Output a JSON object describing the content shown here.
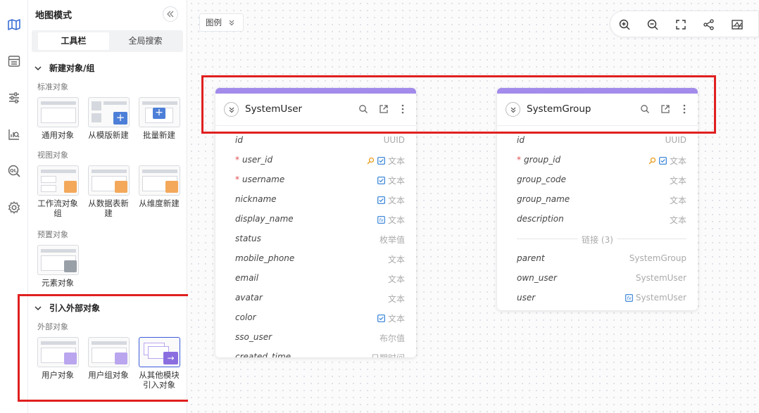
{
  "panel": {
    "title": "地图模式",
    "tabs": [
      "工具栏",
      "全局搜索"
    ],
    "sections": {
      "new_object": {
        "title": "新建对象/组",
        "standard_label": "标准对象",
        "standard_items": [
          "通用对象",
          "从模版新建",
          "批量新建"
        ],
        "view_label": "视图对象",
        "view_items": [
          [
            "工作流对象",
            "组"
          ],
          [
            "从数据表新",
            "建"
          ],
          [
            "从维度新建"
          ]
        ],
        "preset_label": "预置对象",
        "preset_items": [
          "元素对象"
        ]
      },
      "import": {
        "title": "引入外部对象",
        "external_label": "外部对象",
        "items": [
          [
            "用户对象"
          ],
          [
            "用户组对象"
          ],
          [
            "从其他模块",
            "引入对象"
          ]
        ]
      }
    }
  },
  "canvas": {
    "legend_label": "图例",
    "toolbar_icons": [
      "zoom-in-icon",
      "zoom-out-icon",
      "fullscreen-icon",
      "share-icon",
      "minimap-icon"
    ]
  },
  "cards": [
    {
      "name": "SystemUser",
      "fields": [
        {
          "name": "id",
          "type": "UUID",
          "required": false,
          "icons": []
        },
        {
          "name": "user_id",
          "type": "文本",
          "required": true,
          "icons": [
            "key",
            "check"
          ]
        },
        {
          "name": "username",
          "type": "文本",
          "required": true,
          "icons": [
            "check"
          ]
        },
        {
          "name": "nickname",
          "type": "文本",
          "required": false,
          "icons": [
            "check"
          ]
        },
        {
          "name": "display_name",
          "type": "文本",
          "required": false,
          "icons": [
            "fx"
          ]
        },
        {
          "name": "status",
          "type": "枚举值",
          "required": false,
          "icons": []
        },
        {
          "name": "mobile_phone",
          "type": "文本",
          "required": false,
          "icons": []
        },
        {
          "name": "email",
          "type": "文本",
          "required": false,
          "icons": []
        },
        {
          "name": "avatar",
          "type": "文本",
          "required": false,
          "icons": []
        },
        {
          "name": "color",
          "type": "文本",
          "required": false,
          "icons": [
            "check"
          ]
        },
        {
          "name": "sso_user",
          "type": "布尔值",
          "required": false,
          "icons": []
        },
        {
          "name": "created_time",
          "type": "日期时间",
          "required": false,
          "icons": []
        }
      ],
      "links_label": "",
      "links": []
    },
    {
      "name": "SystemGroup",
      "fields": [
        {
          "name": "id",
          "type": "UUID",
          "required": false,
          "icons": []
        },
        {
          "name": "group_id",
          "type": "文本",
          "required": true,
          "icons": [
            "key",
            "check"
          ]
        },
        {
          "name": "group_code",
          "type": "文本",
          "required": false,
          "icons": []
        },
        {
          "name": "group_name",
          "type": "文本",
          "required": false,
          "icons": []
        },
        {
          "name": "description",
          "type": "文本",
          "required": false,
          "icons": []
        }
      ],
      "links_label": "链接 (3)",
      "links": [
        {
          "name": "parent",
          "type": "SystemGroup",
          "icons": []
        },
        {
          "name": "own_user",
          "type": "SystemUser",
          "icons": []
        },
        {
          "name": "user",
          "type": "SystemUser",
          "icons": [
            "fx"
          ]
        }
      ]
    }
  ],
  "colors": {
    "accent": "#a28bea",
    "highlight": "#e02020",
    "icon_blue": "#2f7fd6",
    "key_orange": "#e8a020"
  }
}
